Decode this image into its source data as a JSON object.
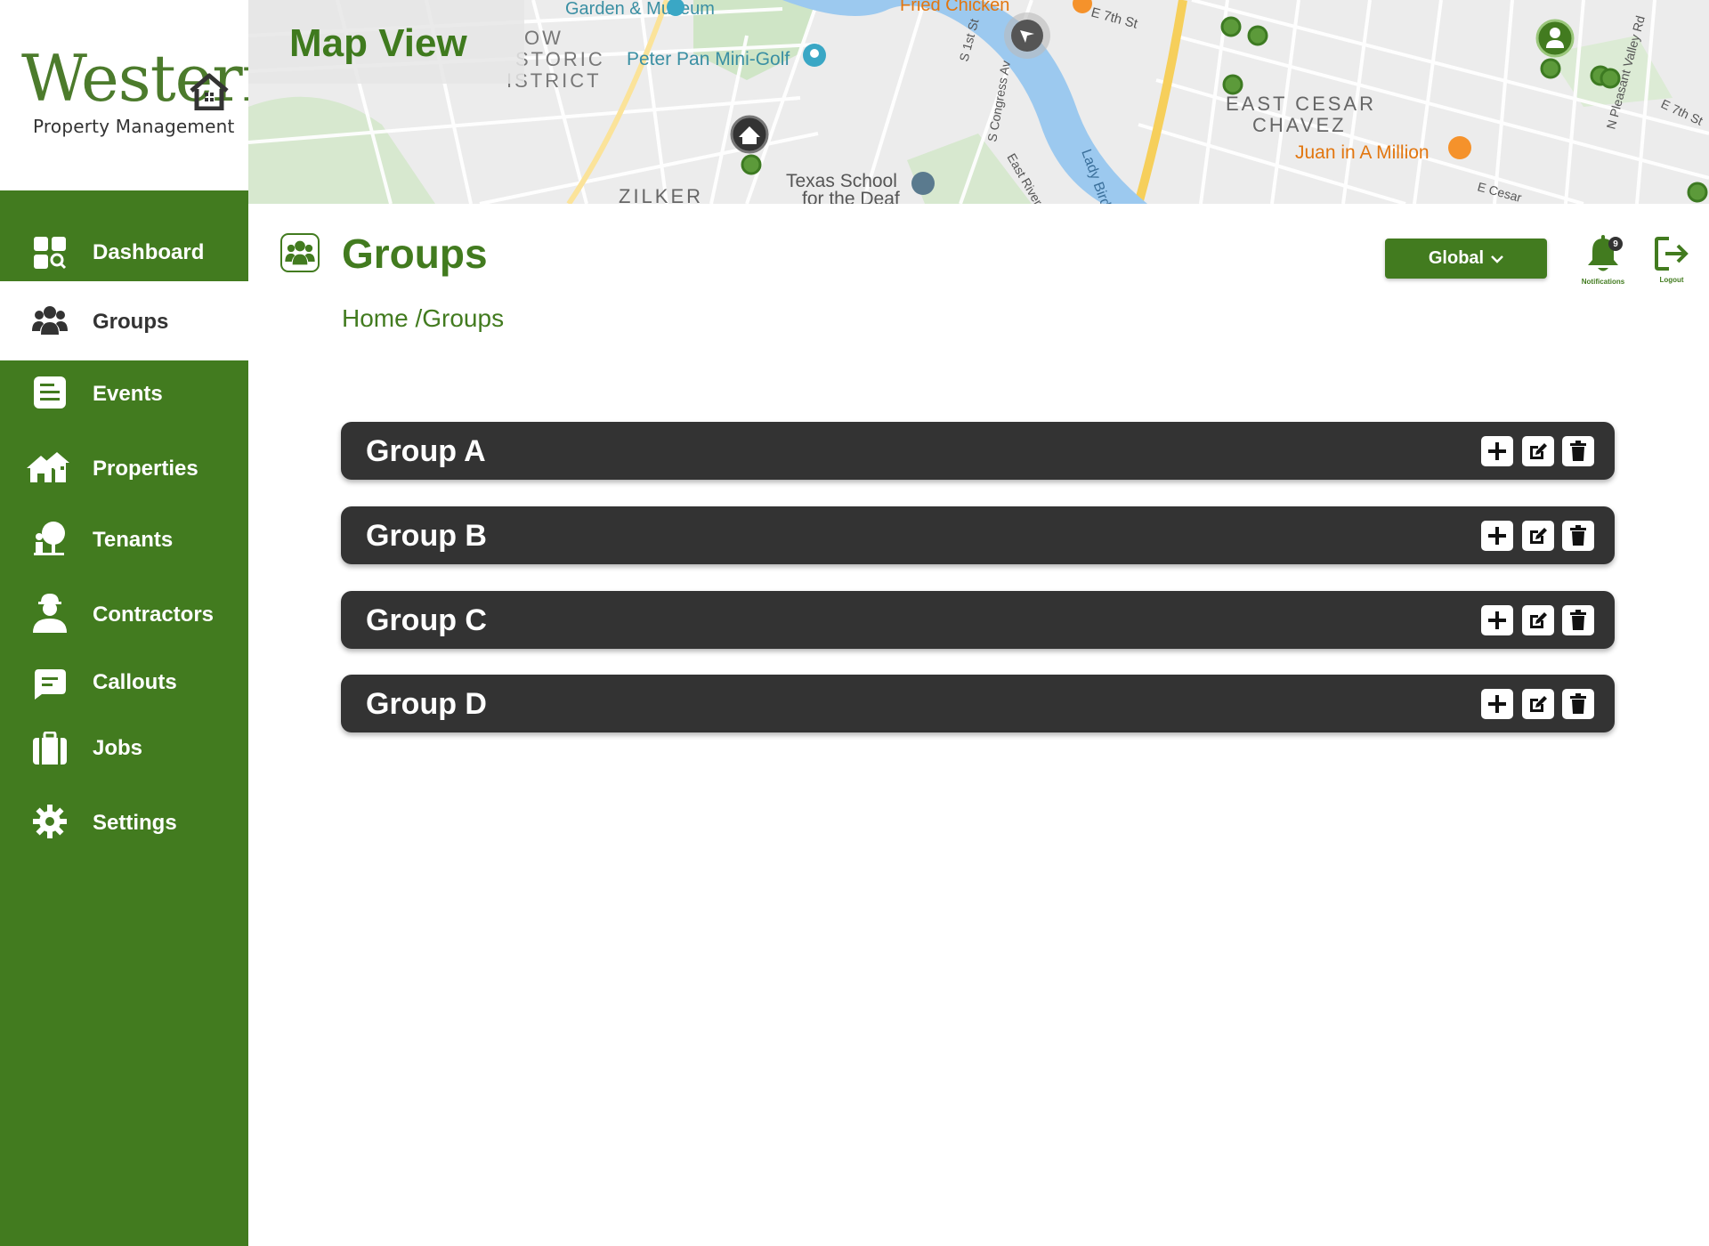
{
  "app": {
    "logo_word": "Western",
    "logo_subtitle": "Property Management"
  },
  "colors": {
    "brand_green": "#427b1f",
    "row_dark": "#333333"
  },
  "sidebar": {
    "items": [
      {
        "label": "Dashboard",
        "icon": "dashboard-icon",
        "active": false
      },
      {
        "label": "Groups",
        "icon": "users-icon",
        "active": true
      },
      {
        "label": "Events",
        "icon": "document-icon",
        "active": false
      },
      {
        "label": "Properties",
        "icon": "houses-icon",
        "active": false
      },
      {
        "label": "Tenants",
        "icon": "tenant-icon",
        "active": false
      },
      {
        "label": "Contractors",
        "icon": "hard-hat-worker-icon",
        "active": false
      },
      {
        "label": "Callouts",
        "icon": "message-icon",
        "active": false
      },
      {
        "label": "Jobs",
        "icon": "briefcase-icon",
        "active": false
      },
      {
        "label": "Settings",
        "icon": "gear-icon",
        "active": false
      }
    ]
  },
  "map": {
    "title": "Map View",
    "labels": [
      "Garden & Museum",
      "Fried Chicken",
      "E 7th St",
      "OW",
      "STORIC",
      "ISTRICT",
      "Peter Pan Mini-Golf",
      "S 1st St",
      "S Congress Av",
      "EAST CESAR",
      "CHAVEZ",
      "Juan in A Million",
      "N Pleasant Valley Rd",
      "E 7th St",
      "ZILKER",
      "Texas School",
      "for the Deaf",
      "East River",
      "Lady Bird",
      "E Cesar"
    ]
  },
  "header": {
    "title": "Groups",
    "breadcrumb": "Home /Groups",
    "scope_label": "Global",
    "notifications_count": "9",
    "notifications_caption": "Notifications",
    "logout_caption": "Logout"
  },
  "groups": [
    {
      "name": "Group A"
    },
    {
      "name": "Group B"
    },
    {
      "name": "Group C"
    },
    {
      "name": "Group D"
    }
  ]
}
